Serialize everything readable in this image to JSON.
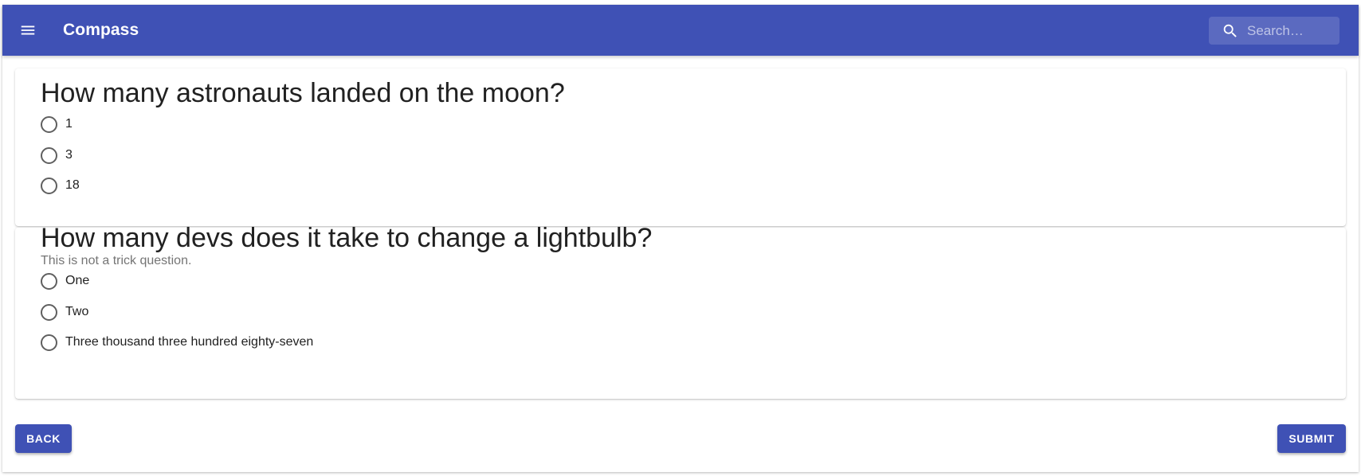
{
  "appbar": {
    "title": "Compass",
    "menu_icon": "menu-icon",
    "search": {
      "placeholder": "Search…",
      "value": "",
      "icon": "search-icon"
    },
    "color": "#3f51b5"
  },
  "questions": [
    {
      "title": "How many astronauts landed on the moon?",
      "subtitle": "",
      "options": [
        "1",
        "3",
        "18"
      ]
    },
    {
      "title": "How many devs does it take to change a lightbulb?",
      "subtitle": "This is not a trick question.",
      "options": [
        "One",
        "Two",
        "Three thousand three hundred eighty-seven"
      ]
    }
  ],
  "actions": {
    "back_label": "BACK",
    "submit_label": "SUBMIT"
  }
}
